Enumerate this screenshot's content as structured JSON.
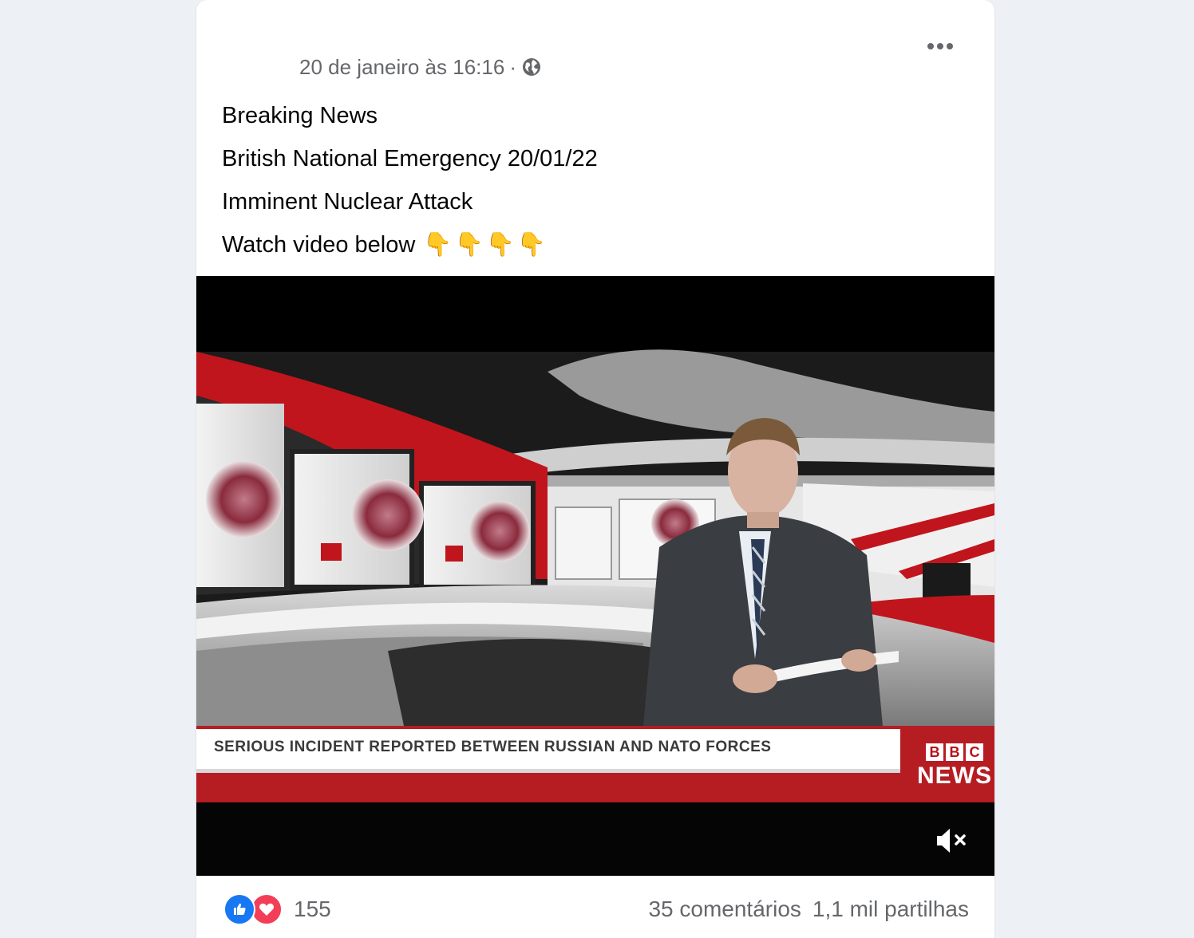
{
  "post": {
    "timestamp": "20 de janeiro às 16:16",
    "separator": "·",
    "privacy_icon": "globe-icon",
    "more_icon": "more-options-icon",
    "lines": [
      "Breaking News",
      "British National Emergency 20/01/22",
      "Imminent Nuclear Attack",
      "Watch video below"
    ],
    "emoji": [
      "👇",
      "👇",
      "👇",
      "👇"
    ]
  },
  "video": {
    "ticker": "SERIOUS INCIDENT REPORTED BETWEEN RUSSIAN AND NATO FORCES",
    "brand_letters": [
      "B",
      "B",
      "C"
    ],
    "brand_sub": "NEWS",
    "mute_icon": "speaker-muted-icon"
  },
  "footer": {
    "reaction_icons": [
      "like-icon",
      "love-icon"
    ],
    "reaction_count": "155",
    "comments": "35 comentários",
    "shares": "1,1 mil partilhas"
  },
  "colors": {
    "page_bg": "#edf0f4",
    "card_bg": "#ffffff",
    "meta_text": "#65676b",
    "body_text": "#050505",
    "like_blue": "#1877f2",
    "love_red": "#f33e58",
    "bbc_red": "#b8121a"
  }
}
